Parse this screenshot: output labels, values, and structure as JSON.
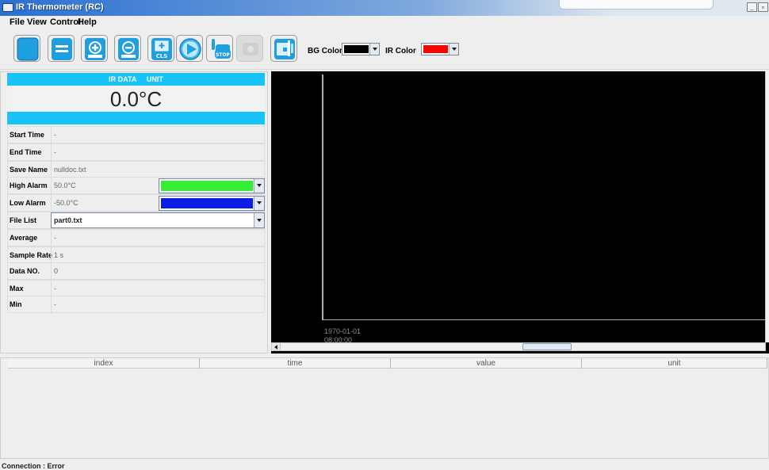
{
  "window": {
    "title": "IR Thermometer (RC)",
    "controls": [
      "_",
      "▫",
      "x"
    ]
  },
  "menubar": {
    "items": [
      "File",
      "View",
      "Control",
      "Help"
    ]
  },
  "toolbar": {
    "buttons": [
      {
        "name": "open-file",
        "icon": "folder-icon"
      },
      {
        "name": "save-file",
        "icon": "save-icon"
      },
      {
        "name": "zoom-in",
        "icon": "zoom-in-icon"
      },
      {
        "name": "zoom-out",
        "icon": "zoom-out-icon"
      },
      {
        "name": "clear-screen",
        "icon": "cls-icon",
        "label": "CLS"
      },
      {
        "name": "play",
        "icon": "play-icon"
      },
      {
        "name": "stop",
        "icon": "stop-hand-icon",
        "label": "STOP"
      },
      {
        "name": "disabled",
        "icon": "disabled-tool-icon"
      },
      {
        "name": "settings",
        "icon": "chart-settings-icon"
      }
    ],
    "bg_color_label": "BG Color",
    "bg_color_value": "#000000",
    "ir_color_label": "IR Color",
    "ir_color_value": "#ff0000"
  },
  "panel": {
    "header_left": "IR DATA",
    "header_right": "UNIT",
    "reading": "0.0°C",
    "rows": {
      "start_time": {
        "label": "Start Time",
        "value": "-"
      },
      "end_time": {
        "label": "End Time",
        "value": "-"
      },
      "save_name": {
        "label": "Save Name",
        "value": "nulldoc.txt"
      },
      "high_alarm": {
        "label": "High Alarm",
        "value": "50.0°C",
        "color": "#33ee33"
      },
      "low_alarm": {
        "label": "Low Alarm",
        "value": "-50.0°C",
        "color": "#0a1ee8"
      },
      "file_list": {
        "label": "File List",
        "value": "part0.txt"
      },
      "average": {
        "label": "Average",
        "value": "-"
      },
      "sample_rate": {
        "label": "Sample Rate",
        "value": "1 s"
      },
      "data_no": {
        "label": "Data NO.",
        "value": "0"
      },
      "max": {
        "label": "Max",
        "value": "-"
      },
      "min": {
        "label": "Min",
        "value": "-"
      }
    }
  },
  "chart": {
    "x_tick_date": "1970-01-01",
    "x_tick_time": "08:00:00",
    "background": "#000000"
  },
  "table": {
    "columns": [
      "index",
      "time",
      "value",
      "unit"
    ],
    "rows": []
  },
  "status": {
    "text": "Connection : Error"
  }
}
